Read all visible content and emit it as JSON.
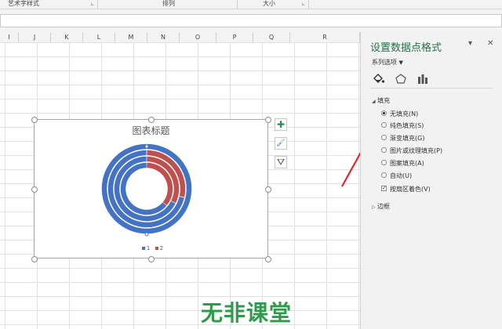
{
  "ribbon": {
    "groups": [
      {
        "label": "艺术字样式"
      },
      {
        "label": "排列"
      },
      {
        "label": "大小"
      }
    ],
    "launcher_glyph": "⊾"
  },
  "columns": [
    "I",
    "J",
    "K",
    "L",
    "M",
    "N",
    "O",
    "P",
    "Q",
    "R"
  ],
  "chart": {
    "title": "图表标题",
    "legend": [
      {
        "label": "1",
        "color": "#4472c4"
      },
      {
        "label": "2",
        "color": "#c0504d"
      }
    ],
    "side_buttons": [
      {
        "icon": "plus-icon",
        "glyph": "✚"
      },
      {
        "icon": "brush-icon",
        "glyph": "🖌"
      },
      {
        "icon": "filter-icon",
        "glyph": "⛛"
      }
    ]
  },
  "chart_data": {
    "type": "doughnut",
    "title": "图表标题",
    "series": [
      {
        "name": "1",
        "color": "#4472c4",
        "values": [
          75,
          25
        ]
      },
      {
        "name": "2",
        "color": "#c0504d",
        "values": [
          25,
          75
        ]
      }
    ],
    "note_visible": "multiple concentric doughnut rings; series 1 blue occupies left portion, series 2 red right portion"
  },
  "panel": {
    "title": "设置数据点格式",
    "dropdown_glyph": "▾",
    "close_glyph": "✕",
    "series_options": "系列选项",
    "fill_section": "填充",
    "fill_options": [
      {
        "label": "无填充(N)",
        "checked": true
      },
      {
        "label": "纯色填充(S)",
        "checked": false
      },
      {
        "label": "渐变填充(G)",
        "checked": false
      },
      {
        "label": "图片或纹理填充(P)",
        "checked": false
      },
      {
        "label": "图案填充(A)",
        "checked": false
      },
      {
        "label": "自动(U)",
        "checked": false
      }
    ],
    "vary_colors": {
      "label": "按扇区着色(V)",
      "checked": true
    },
    "border_section": "边框",
    "expand_open": "◢",
    "expand_closed": "▷"
  },
  "annotation": {
    "arrow_color": "#e0242b"
  },
  "watermark": "无非课堂"
}
